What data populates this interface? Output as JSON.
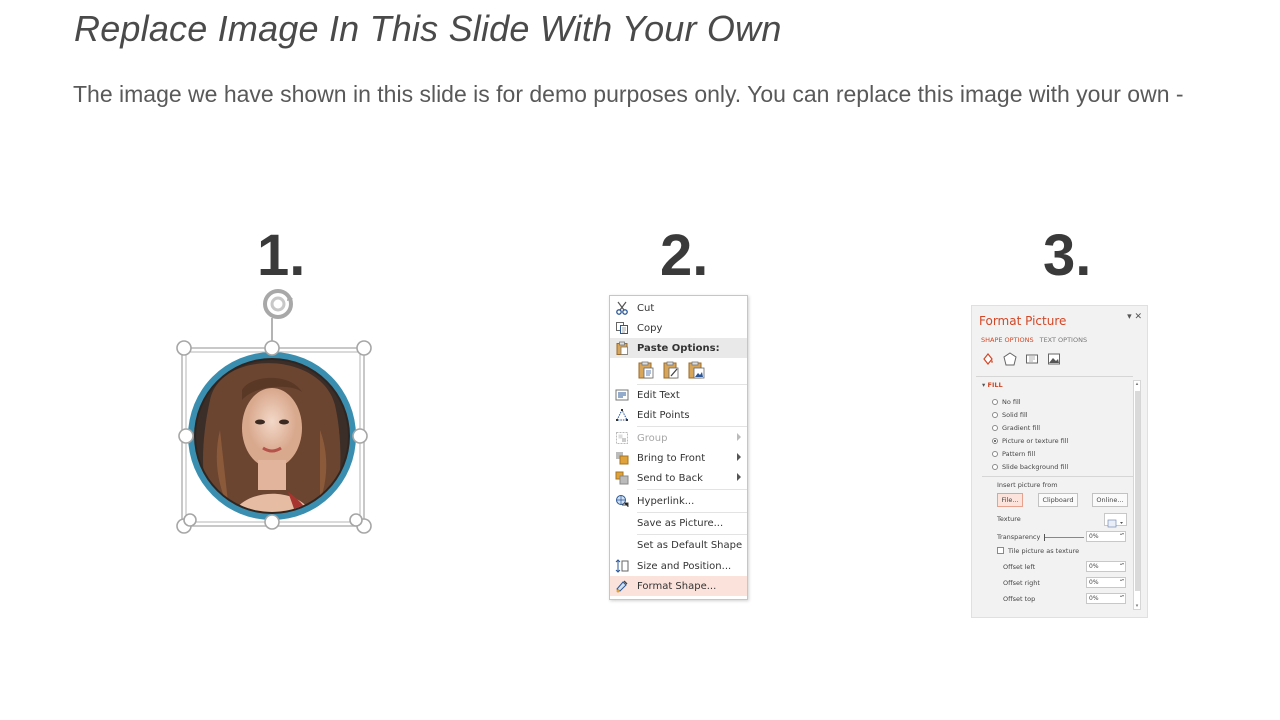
{
  "slide": {
    "title": "Replace Image In This Slide With Your Own",
    "subtitle": "The image we have shown in this slide is for demo purposes only. You can replace this image with your own -"
  },
  "steps": [
    "1.",
    "2.",
    "3."
  ],
  "colors": {
    "accent": "#d24726",
    "ring": "#3a8fb0",
    "menu_highlight": "#fbe3dc"
  },
  "context_menu": {
    "items": [
      {
        "label": "Cut",
        "icon": "scissors-icon"
      },
      {
        "label": "Copy",
        "icon": "copy-icon"
      },
      {
        "label": "Paste Options:",
        "icon": "clipboard-icon"
      },
      {
        "label": "Edit Text",
        "icon": "edit-text-icon"
      },
      {
        "label": "Edit Points",
        "icon": "edit-points-icon"
      },
      {
        "label": "Group",
        "icon": "group-icon",
        "disabled": true
      },
      {
        "label": "Bring to Front",
        "icon": "bring-front-icon"
      },
      {
        "label": "Send to Back",
        "icon": "send-back-icon"
      },
      {
        "label": "Hyperlink...",
        "icon": "hyperlink-icon"
      },
      {
        "label": "Save as Picture...",
        "icon": ""
      },
      {
        "label": "Set as Default Shape",
        "icon": ""
      },
      {
        "label": "Size and Position...",
        "icon": "size-position-icon"
      },
      {
        "label": "Format Shape...",
        "icon": "format-shape-icon"
      }
    ]
  },
  "format_picture": {
    "title": "Format Picture",
    "controls": "▾ ✕",
    "tabs": [
      "SHAPE OPTIONS",
      "TEXT OPTIONS"
    ],
    "section": "FILL",
    "fill_options": [
      "No fill",
      "Solid fill",
      "Gradient fill",
      "Picture or texture fill",
      "Pattern fill",
      "Slide background fill"
    ],
    "selected_fill": "Picture or texture fill",
    "insert_from_label": "Insert picture from",
    "buttons": [
      "File...",
      "Clipboard",
      "Online..."
    ],
    "texture_label": "Texture",
    "transparency_label": "Transparency",
    "transparency_value": "0%",
    "tile_label": "Tile picture as texture",
    "offset_left_label": "Offset left",
    "offset_left_value": "0%",
    "offset_right_label": "Offset right",
    "offset_right_value": "0%",
    "offset_top_label": "Offset top",
    "offset_top_value": "0%"
  }
}
